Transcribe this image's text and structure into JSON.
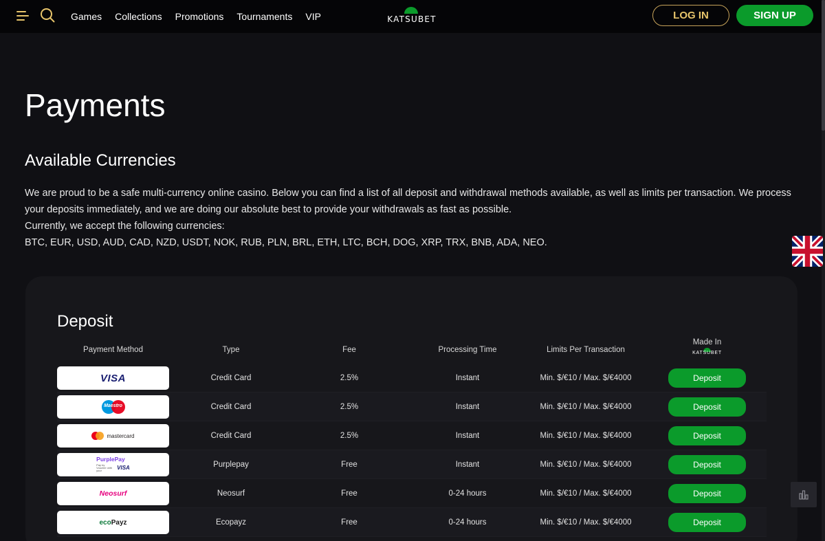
{
  "header": {
    "nav": [
      "Games",
      "Collections",
      "Promotions",
      "Tournaments",
      "VIP"
    ],
    "logo_text": "KATSUBET",
    "login_label": "LOG IN",
    "signup_label": "SIGN UP"
  },
  "page": {
    "title": "Payments",
    "section_title": "Available Currencies",
    "intro_line1": "We are proud to be a safe multi-currency online casino. Below you can find a list of all deposit and withdrawal methods available, as well as limits per transaction. We process your deposits immediately, and we are doing our absolute best to provide your withdrawals as fast as possible.",
    "intro_line2": "Currently, we accept the following currencies:",
    "currencies": "BTC, EUR, USD, AUD, CAD, NZD, USDT, NOK, RUB, PLN, BRL, ETH, LTC, BCH, DOG, XRP, TRX, BNB, ADA, NEO."
  },
  "deposit": {
    "title": "Deposit",
    "headers": {
      "method": "Payment Method",
      "type": "Type",
      "fee": "Fee",
      "time": "Processing Time",
      "limits": "Limits Per Transaction",
      "made_in": "Made In",
      "made_in_logo": "KATSUBET"
    },
    "rows": [
      {
        "method": "VISA",
        "type": "Credit Card",
        "fee": "2.5%",
        "time": "Instant",
        "limits": "Min. $/€10 / Max. $/€4000",
        "action": "Deposit"
      },
      {
        "method": "Maestro",
        "type": "Credit Card",
        "fee": "2.5%",
        "time": "Instant",
        "limits": "Min. $/€10 / Max. $/€4000",
        "action": "Deposit"
      },
      {
        "method": "mastercard",
        "type": "Credit Card",
        "fee": "2.5%",
        "time": "Instant",
        "limits": "Min. $/€10 / Max. $/€4000",
        "action": "Deposit"
      },
      {
        "method": "PurplePay",
        "method_sub": "Pay by Voucher with your",
        "method_sub2": "VISA",
        "type": "Purplepay",
        "fee": "Free",
        "time": "Instant",
        "limits": "Min. $/€10 / Max. $/€4000",
        "action": "Deposit"
      },
      {
        "method": "Neosurf",
        "type": "Neosurf",
        "fee": "Free",
        "time": "0-24 hours",
        "limits": "Min. $/€10 / Max. $/€4000",
        "action": "Deposit"
      },
      {
        "method_a": "eco",
        "method_b": "Payz",
        "type": "Ecopayz",
        "fee": "Free",
        "time": "0-24 hours",
        "limits": "Min. $/€10 / Max. $/€4000",
        "action": "Deposit"
      }
    ]
  },
  "colors": {
    "background": "#101014",
    "header": "#050507",
    "accent_green": "#0b9b2b",
    "accent_gold": "#e8c56b",
    "card": "#17171b"
  },
  "icons": [
    "menu-icon",
    "search-icon",
    "uk-flag-icon",
    "stats-icon"
  ]
}
